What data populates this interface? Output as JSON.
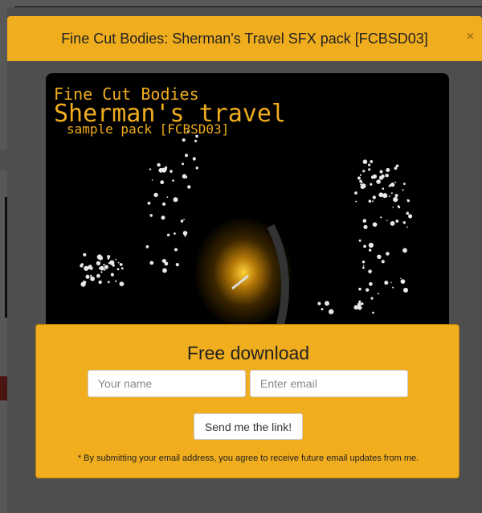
{
  "modal": {
    "title": "Fine Cut Bodies: Sherman's Travel SFX pack [FCBSD03]",
    "close_symbol": "×"
  },
  "cover_art": {
    "line1": "Fine Cut Bodies",
    "line2": "Sherman's travel",
    "line3": "sample pack [FCBSD03]",
    "text_color": "#f0ad1e"
  },
  "download": {
    "title": "Free download",
    "name_placeholder": "Your name",
    "email_placeholder": "Enter email",
    "submit_label": "Send me the link!",
    "disclaimer": "* By submitting your email address, you agree to receive future email updates from me."
  },
  "colors": {
    "accent": "#f0ad1e",
    "overlay": "#4e4e4e"
  }
}
